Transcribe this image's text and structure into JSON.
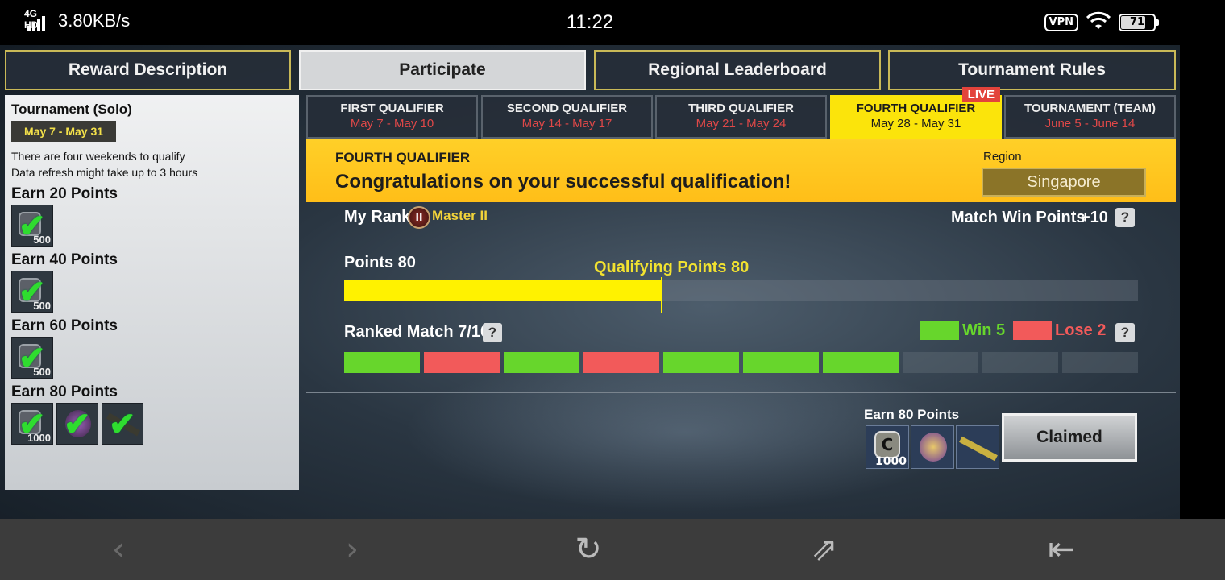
{
  "status_bar": {
    "network": "4G HD",
    "speed": "3.80KB/s",
    "time": "11:22",
    "vpn": "VPN",
    "battery": "71"
  },
  "top_tabs": [
    {
      "label": "Reward Description",
      "active": false
    },
    {
      "label": "Participate",
      "active": true
    },
    {
      "label": "Regional Leaderboard",
      "active": false
    },
    {
      "label": "Tournament Rules",
      "active": false
    }
  ],
  "left_panel": {
    "title": "Tournament (Solo)",
    "date_range": "May 7 - May 31",
    "info_line1": "There are four weekends to qualify",
    "info_line2": "Data refresh might take up to 3 hours",
    "milestones": [
      {
        "label": "Earn 20 Points",
        "reward_amount": "500"
      },
      {
        "label": "Earn 40 Points",
        "reward_amount": "500"
      },
      {
        "label": "Earn 60 Points",
        "reward_amount": "500"
      },
      {
        "label": "Earn 80 Points",
        "reward_amount": "1000"
      }
    ]
  },
  "qualifier_tabs": [
    {
      "name": "FIRST QUALIFIER",
      "dates": "May 7 - May 10"
    },
    {
      "name": "SECOND QUALIFIER",
      "dates": "May 14 - May 17"
    },
    {
      "name": "THIRD QUALIFIER",
      "dates": "May 21 - May 24"
    },
    {
      "name": "FOURTH QUALIFIER",
      "dates": "May 28 - May 31",
      "active": true,
      "badge": "LIVE"
    },
    {
      "name": "TOURNAMENT (TEAM)",
      "dates": "June 5 - June 14"
    }
  ],
  "banner": {
    "title": "FOURTH QUALIFIER",
    "message": "Congratulations on your successful qualification!",
    "region_label": "Region",
    "region_value": "Singapore"
  },
  "stats": {
    "my_rank_label": "My Rank:",
    "rank_badge": "II",
    "rank_name": "Master II",
    "match_win_label": "Match Win Points",
    "match_win_value": "+10",
    "points_label": "Points 80",
    "qualifying_label": "Qualifying Points 80",
    "points_fill_fraction": 0.4,
    "ranked_match_label": "Ranked Match 7/10",
    "win_label": "Win 5",
    "lose_label": "Lose 2",
    "match_results": [
      "win",
      "lose",
      "win",
      "lose",
      "win",
      "win",
      "win",
      "none",
      "none",
      "none"
    ],
    "help_glyph": "?"
  },
  "claim": {
    "earn_label": "Earn 80 Points",
    "reward_amount": "1000",
    "coin_glyph": "C",
    "button_label": "Claimed"
  },
  "colors": {
    "accent_yellow": "#fff200",
    "win_green": "#67d62c",
    "lose_red": "#f25a5a",
    "date_red": "#e04848"
  },
  "icons": {
    "check": "✔",
    "back": "‹",
    "forward": "›",
    "refresh": "↻",
    "share": "⇗",
    "exit": "⇤"
  }
}
